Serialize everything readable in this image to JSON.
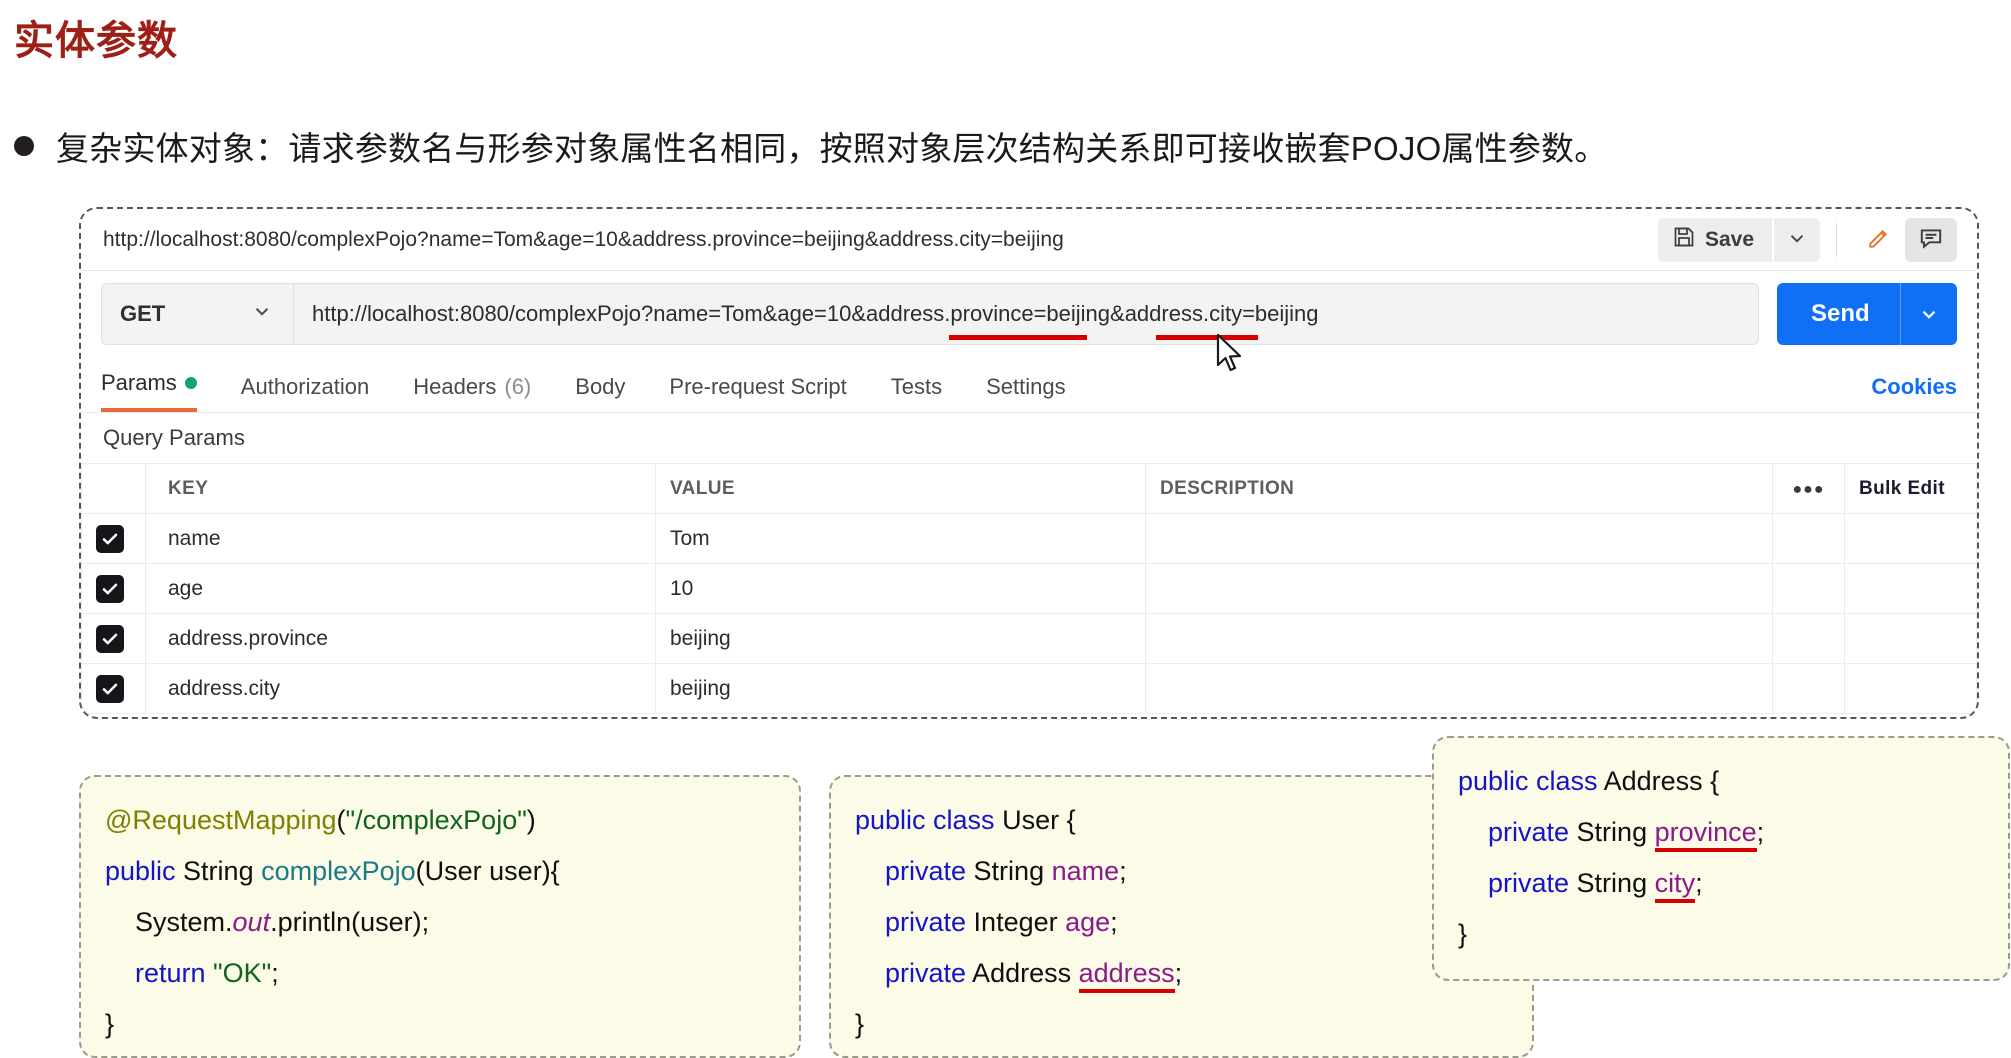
{
  "slide": {
    "title": "实体参数",
    "bullet": "复杂实体对象：请求参数名与形参对象属性名相同，按照对象层次结构关系即可接收嵌套POJO属性参数。"
  },
  "postman": {
    "tab_title": "http://localhost:8080/complexPojo?name=Tom&age=10&address.province=beijing&address.city=beijing",
    "save_label": "Save",
    "request": {
      "method": "GET",
      "url": "http://localhost:8080/complexPojo?name=Tom&age=10&address.province=beijing&address.city=beijing",
      "send_label": "Send"
    },
    "tabs": [
      {
        "label": "Params",
        "active": true,
        "dot": true
      },
      {
        "label": "Authorization",
        "active": false
      },
      {
        "label": "Headers",
        "count": "(6)",
        "active": false
      },
      {
        "label": "Body",
        "active": false
      },
      {
        "label": "Pre-request Script",
        "active": false
      },
      {
        "label": "Tests",
        "active": false
      },
      {
        "label": "Settings",
        "active": false
      }
    ],
    "cookies_label": "Cookies",
    "query_params_label": "Query Params",
    "table": {
      "headers": {
        "key": "KEY",
        "value": "VALUE",
        "description": "DESCRIPTION",
        "bulk_edit": "Bulk Edit"
      },
      "rows": [
        {
          "checked": true,
          "key": "name",
          "value": "Tom",
          "description": ""
        },
        {
          "checked": true,
          "key": "age",
          "value": "10",
          "description": ""
        },
        {
          "checked": true,
          "key": "address.province",
          "value": "beijing",
          "description": ""
        },
        {
          "checked": true,
          "key": "address.city",
          "value": "beijing",
          "description": ""
        }
      ]
    }
  },
  "code": {
    "controller": {
      "line1_anno": "@RequestMapping",
      "line1_paren_open": "(",
      "line1_str": "\"/complexPojo\"",
      "line1_paren_close": ")",
      "line2_public": "public",
      "line2_string": " String ",
      "line2_method": "complexPojo",
      "line2_args": "(User user){",
      "line3": "    System.",
      "line3_out": "out",
      "line3_rest": ".println(user);",
      "line4_return": "    return ",
      "line4_ok": "\"OK\"",
      "line4_semi": ";",
      "line5": "}"
    },
    "user": {
      "l1_kw": "public class",
      "l1_name": " User {",
      "l2_kw": "    private",
      "l2_type": " String ",
      "l2_field": "name",
      "l2_semi": ";",
      "l3_kw": "    private",
      "l3_type": " Integer ",
      "l3_field": "age",
      "l3_semi": ";",
      "l4_kw": "    private",
      "l4_type": " Address ",
      "l4_field": "address",
      "l4_semi": ";",
      "l5": "}"
    },
    "address": {
      "l1_kw": "public class",
      "l1_name": " Address {",
      "l2_kw": "    private",
      "l2_type": " String ",
      "l2_field": "province",
      "l2_semi": ";",
      "l3_kw": "    private",
      "l3_type": " String ",
      "l3_field": "city",
      "l3_semi": ";",
      "l4": "}"
    }
  },
  "colors": {
    "title_red": "#9e1f16",
    "send_blue": "#0f6ff5",
    "accent_orange": "#e8693a",
    "status_green": "#10a56b",
    "underline_red": "#d60000",
    "code_bg": "#fbfbe8"
  }
}
